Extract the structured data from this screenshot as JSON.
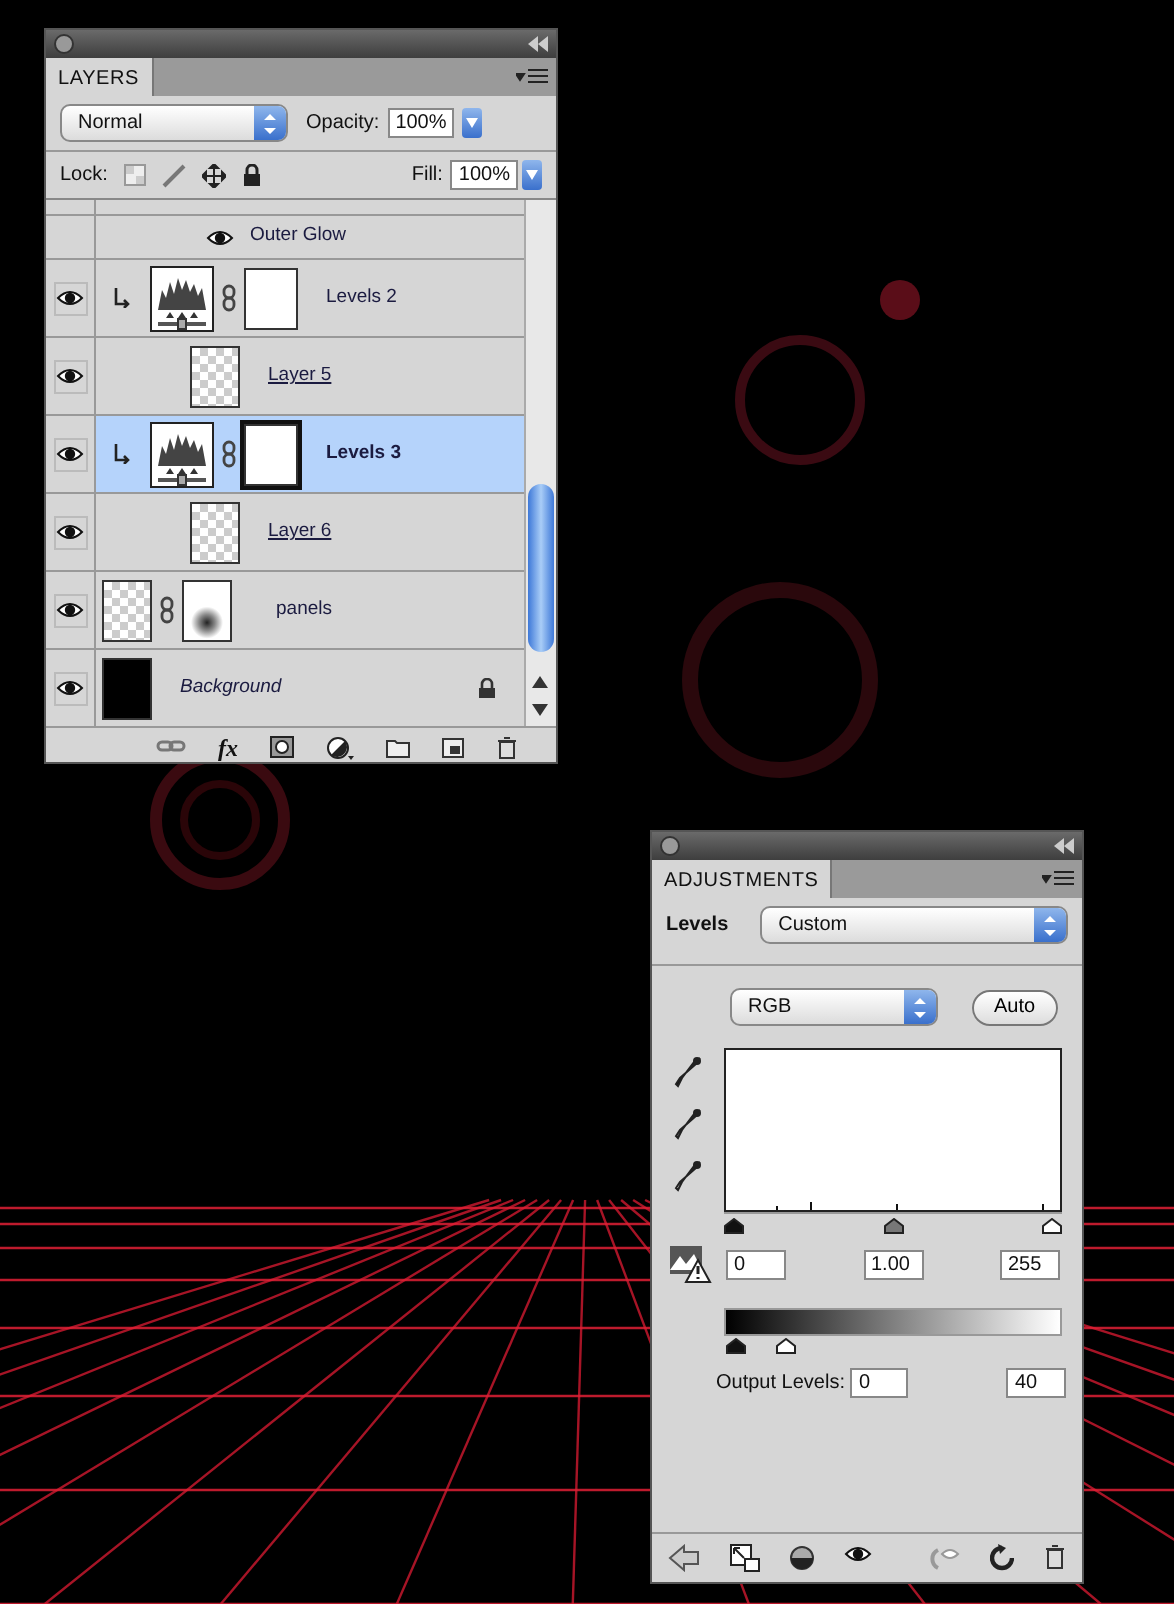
{
  "layers_panel": {
    "tab": "LAYERS",
    "blend_mode": "Normal",
    "opacity_label": "Opacity:",
    "opacity": "100%",
    "lock_label": "Lock:",
    "fill_label": "Fill:",
    "fill": "100%",
    "effect": {
      "name": "Outer Glow",
      "visible": true
    },
    "fx_button": "fx",
    "layers": [
      {
        "name": "Levels 2",
        "kind": "adjustment",
        "clipped": true,
        "clip_base": false,
        "selected": false,
        "visible": true
      },
      {
        "name": "Layer 5",
        "kind": "pixel",
        "clipped": false,
        "clip_base": true,
        "selected": false,
        "visible": true
      },
      {
        "name": "Levels 3",
        "kind": "adjustment",
        "clipped": true,
        "clip_base": false,
        "selected": true,
        "visible": true
      },
      {
        "name": "Layer 6",
        "kind": "pixel",
        "clipped": false,
        "clip_base": true,
        "selected": false,
        "visible": true
      },
      {
        "name": "panels",
        "kind": "masked",
        "clipped": false,
        "clip_base": false,
        "selected": false,
        "visible": true
      },
      {
        "name": "Background",
        "kind": "background",
        "clipped": false,
        "clip_base": false,
        "selected": false,
        "visible": true
      }
    ]
  },
  "adjustments_panel": {
    "tab": "ADJUSTMENTS",
    "type_label": "Levels",
    "preset": "Custom",
    "channel": "RGB",
    "auto_button": "Auto",
    "input_sliders": [
      {
        "level": 0
      },
      {
        "level": 0.5
      },
      {
        "level": 1
      }
    ],
    "input_values": [
      "0",
      "1.00",
      "255"
    ],
    "output_label": "Output Levels:",
    "output_sliders": [
      {
        "level": 0
      },
      {
        "level": 0.157
      }
    ],
    "output_values": [
      "0",
      "40"
    ]
  }
}
